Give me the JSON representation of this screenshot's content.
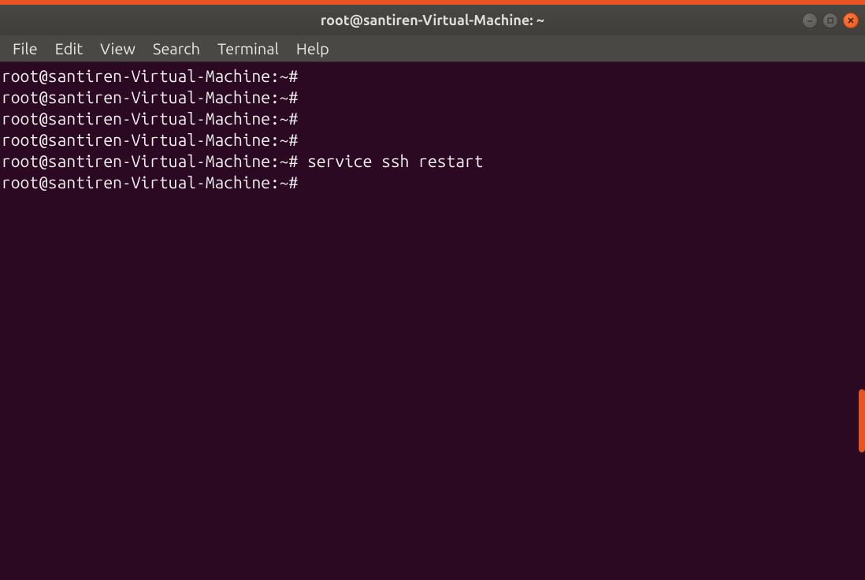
{
  "title": "root@santiren-Virtual-Machine: ~",
  "menu": {
    "file": "File",
    "edit": "Edit",
    "view": "View",
    "search": "Search",
    "terminal": "Terminal",
    "help": "Help"
  },
  "prompt": "root@santiren-Virtual-Machine:~#",
  "lines": [
    {
      "text": "root@santiren-Virtual-Machine:~#"
    },
    {
      "text": "root@santiren-Virtual-Machine:~#"
    },
    {
      "text": "root@santiren-Virtual-Machine:~#"
    },
    {
      "text": "root@santiren-Virtual-Machine:~#"
    },
    {
      "text": "root@santiren-Virtual-Machine:~# service ssh restart"
    },
    {
      "text": "root@santiren-Virtual-Machine:~# "
    }
  ],
  "colors": {
    "accent": "#e95420",
    "termBg": "#2c0922",
    "menubarBg": "#494844",
    "titlebarBg": "#434240",
    "fg": "#eeeeec"
  }
}
